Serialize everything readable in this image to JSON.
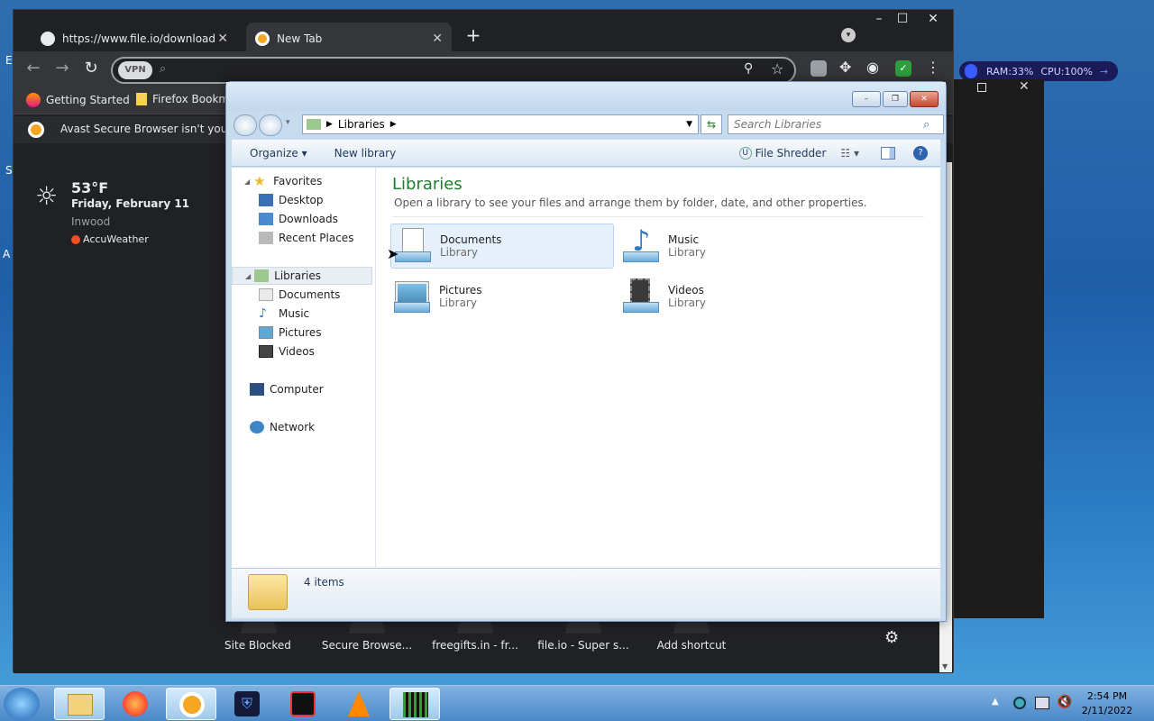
{
  "desktop": {
    "left_labels": [
      "E",
      "S",
      "A"
    ]
  },
  "browser": {
    "tabs": [
      {
        "title": "https://www.file.io/download/Tqt",
        "close": "✕"
      },
      {
        "title": "New Tab",
        "close": "✕"
      }
    ],
    "new_tab": "+",
    "window_controls": {
      "minimize": "–",
      "maximize": "☐",
      "close": "✕"
    },
    "omnibox": {
      "vpn_label": "VPN",
      "placeholder": ""
    },
    "bookmarks": [
      "Getting Started",
      "Firefox Bookma"
    ],
    "infobar_text": "Avast Secure Browser isn't your d",
    "weather": {
      "temp": "53°F",
      "date": "Friday, February 11",
      "location": "Inwood",
      "provider": "AccuWeather"
    },
    "shortcuts": [
      "Site Blocked",
      "Secure Browse...",
      "freegifts.in - fr...",
      "file.io - Super s...",
      "Add shortcut"
    ]
  },
  "explorer": {
    "breadcrumb": "Libraries",
    "search_placeholder": "Search Libraries",
    "commands": {
      "organize": "Organize",
      "new_library": "New library",
      "file_shredder": "File Shredder"
    },
    "nav": {
      "favorites": "Favorites",
      "favorites_items": [
        "Desktop",
        "Downloads",
        "Recent Places"
      ],
      "libraries": "Libraries",
      "libraries_items": [
        "Documents",
        "Music",
        "Pictures",
        "Videos"
      ],
      "computer": "Computer",
      "network": "Network"
    },
    "heading": "Libraries",
    "subheading": "Open a library to see your files and arrange them by folder, date, and other properties.",
    "libraries": [
      {
        "name": "Documents",
        "type": "Library"
      },
      {
        "name": "Music",
        "type": "Library"
      },
      {
        "name": "Pictures",
        "type": "Library"
      },
      {
        "name": "Videos",
        "type": "Library"
      }
    ],
    "details": {
      "count": "4 items"
    }
  },
  "monitor": {
    "ram": "RAM:33%",
    "cpu": "CPU:100%"
  },
  "taskbar": {
    "time": "2:54 PM",
    "date": "2/11/2022"
  }
}
